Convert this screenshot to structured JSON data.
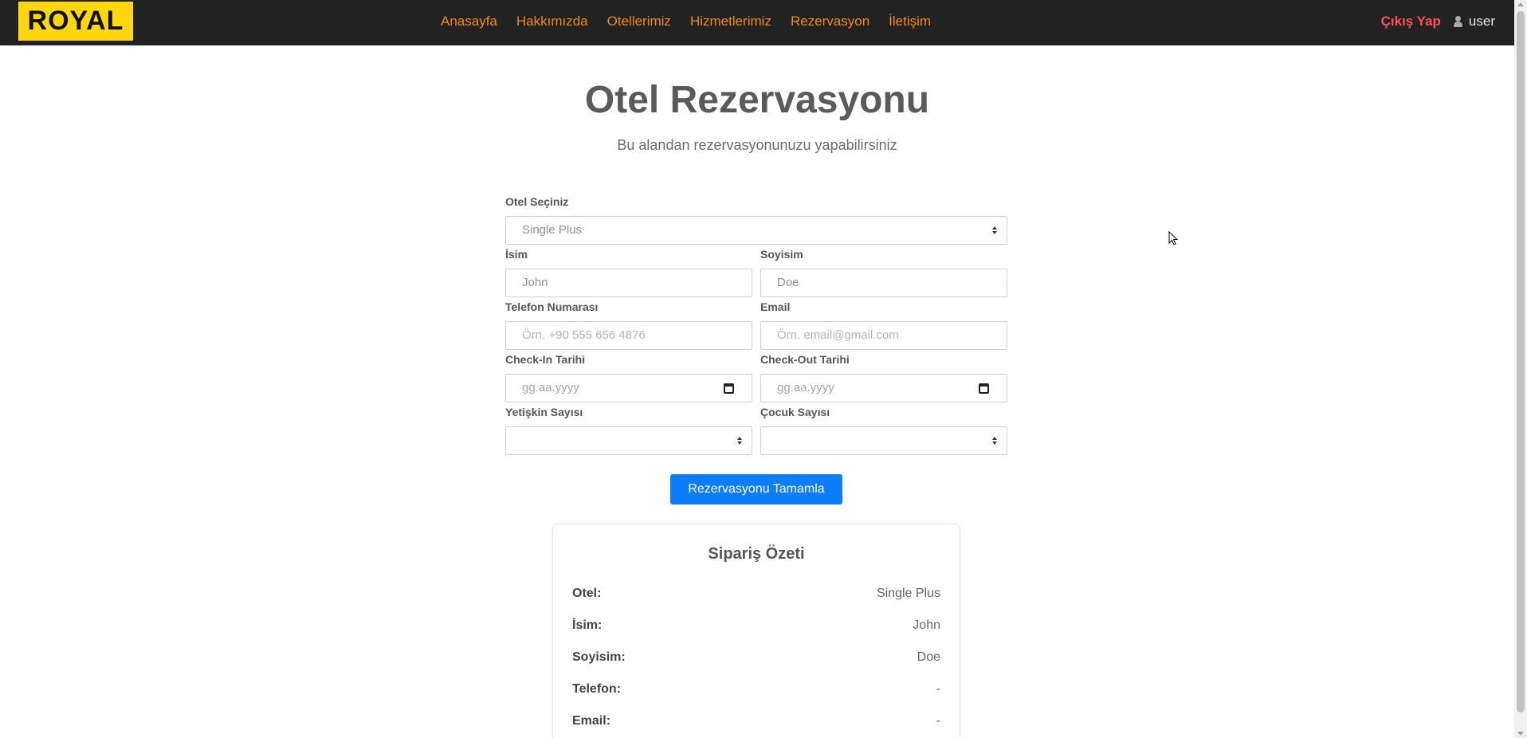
{
  "brand": {
    "logo": "ROYAL",
    "logo_color": "#ffd70f"
  },
  "nav": {
    "links": [
      "Anasayfa",
      "Hakkımızda",
      "Otellerimiz",
      "Hizmetlerimiz",
      "Rezervasyon",
      "İletişim"
    ],
    "logout": "Çıkış Yap",
    "user": "user",
    "link_color": "#f28a12",
    "logout_color": "#ff4f5e"
  },
  "hero": {
    "title": "Otel Rezervasyonu",
    "subtitle": "Bu alandan rezervasyonunuzu yapabilirsiniz"
  },
  "form": {
    "hotel": {
      "label": "Otel Seçiniz",
      "value": "Single Plus"
    },
    "first_name": {
      "label": "İsim",
      "value": "John"
    },
    "last_name": {
      "label": "Soyisim",
      "value": "Doe"
    },
    "phone": {
      "label": "Telefon Numarası",
      "placeholder": "Örn. +90 555 656 4876"
    },
    "email": {
      "label": "Email",
      "placeholder": "Örn. email@gmail.com"
    },
    "check_in": {
      "label": "Check-In Tarihi",
      "placeholder": "gg.aa.yyyy"
    },
    "check_out": {
      "label": "Check-Out Tarihi",
      "placeholder": "gg.aa.yyyy"
    },
    "adults": {
      "label": "Yetişkin Sayısı",
      "value": ""
    },
    "children": {
      "label": "Çocuk Sayısı",
      "value": ""
    },
    "submit": "Rezervasyonu Tamamla",
    "submit_color": "#0d7efb"
  },
  "summary": {
    "title": "Sipariş Özeti",
    "rows": [
      {
        "key": "Otel:",
        "value": "Single Plus"
      },
      {
        "key": "İsim:",
        "value": "John"
      },
      {
        "key": "Soyisim:",
        "value": "Doe"
      },
      {
        "key": "Telefon:",
        "value": "-"
      },
      {
        "key": "Email:",
        "value": "-"
      }
    ]
  }
}
